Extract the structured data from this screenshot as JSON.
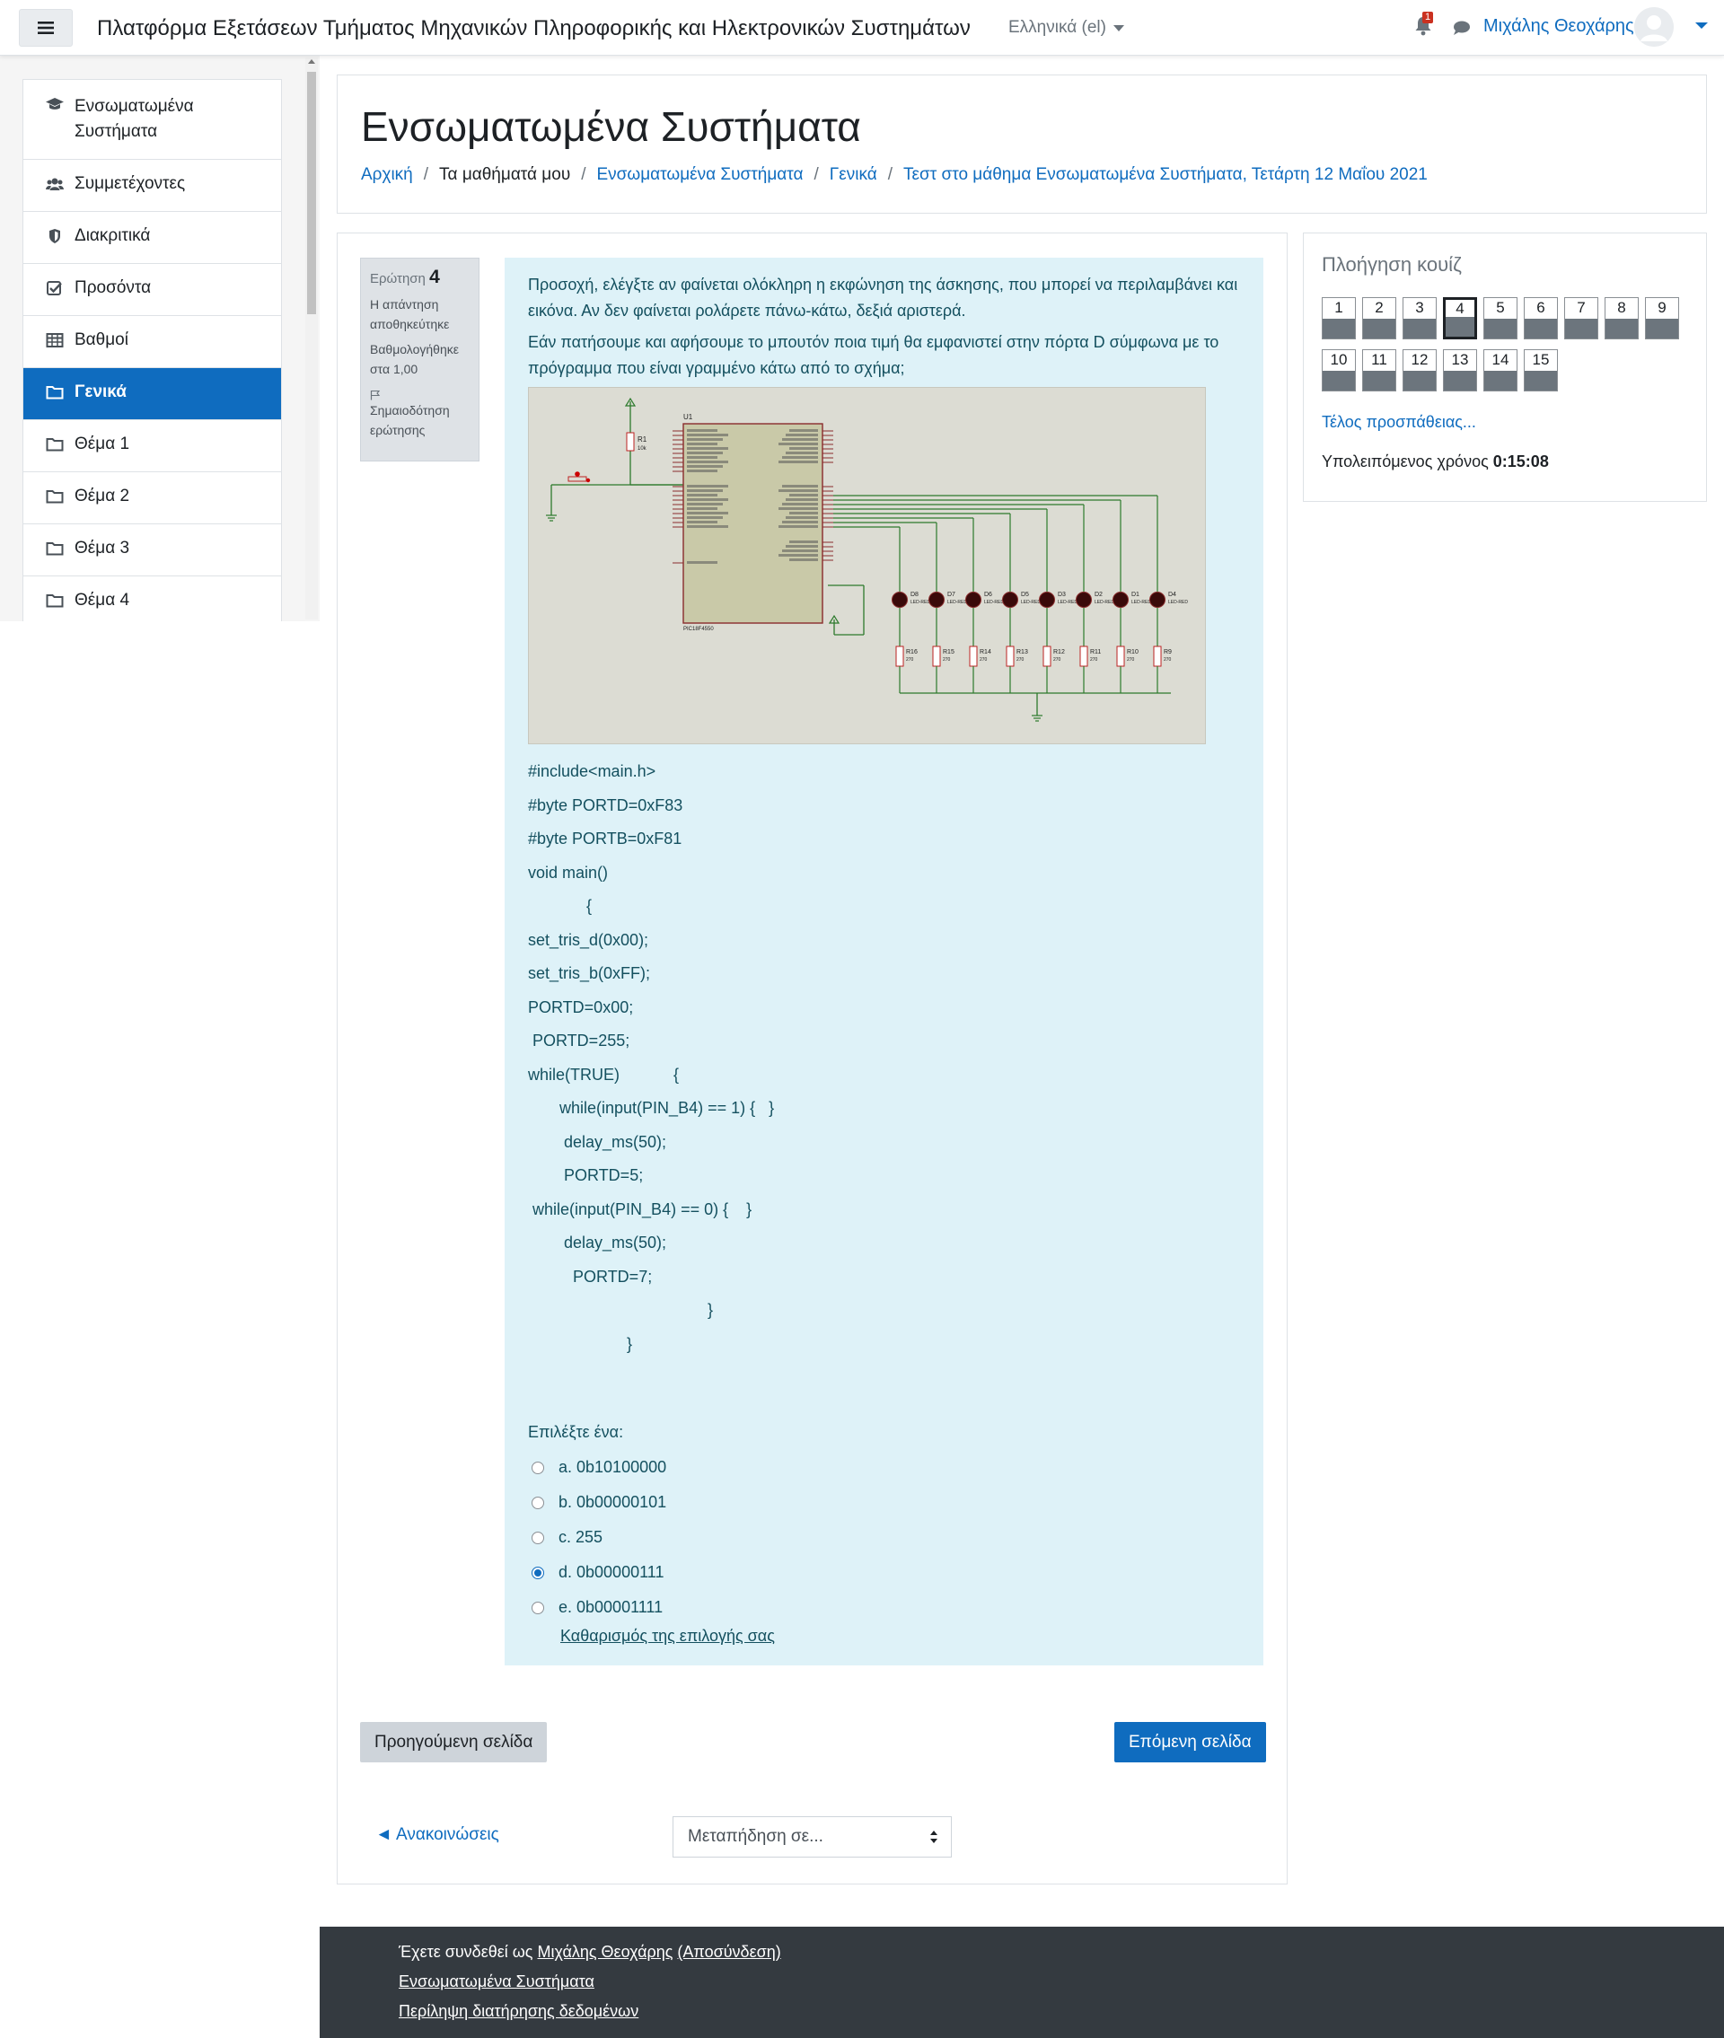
{
  "navbar": {
    "site_name": "Πλατφόρμα Εξετάσεων Τμήματος Μηχανικών Πληροφορικής και Ηλεκτρονικών Συστημάτων",
    "language": "Ελληνικά ‎(el)‎",
    "notification_count": "1",
    "user_name": "Μιχάλης Θεοχάρης",
    "icons": {
      "menu": "hamburger-icon",
      "notifications": "bell-icon",
      "messages": "chat-icon",
      "user": "avatar-icon"
    }
  },
  "drawer": {
    "items": [
      {
        "label": "Ενσωματωμένα Συστήματα",
        "icon": "graduation-cap-icon"
      },
      {
        "label": "Συμμετέχοντες",
        "icon": "users-icon"
      },
      {
        "label": "Διακριτικά",
        "icon": "shield-icon"
      },
      {
        "label": "Προσόντα",
        "icon": "checkbox-icon"
      },
      {
        "label": "Βαθμοί",
        "icon": "table-icon"
      },
      {
        "label": "Γενικά",
        "icon": "folder-icon",
        "active": true
      },
      {
        "label": "Θέμα 1",
        "icon": "folder-icon"
      },
      {
        "label": "Θέμα 2",
        "icon": "folder-icon"
      },
      {
        "label": "Θέμα 3",
        "icon": "folder-icon"
      },
      {
        "label": "Θέμα 4",
        "icon": "folder-icon"
      }
    ]
  },
  "header": {
    "title": "Ενσωματωμένα Συστήματα",
    "breadcrumb": [
      "Αρχική",
      "Τα μαθήματά μου",
      "Ενσωματωμένα Συστήματα",
      "Γενικά",
      "Τεστ στο μάθημα Ενσωματωμένα Συστήματα, Τετάρτη 12 Μαΐου 2021"
    ]
  },
  "question": {
    "info": {
      "label": "Ερώτηση",
      "number": "4",
      "state": "Η απάντηση αποθηκεύτηκε",
      "grade": "Βαθμολογήθηκε στα 1,00",
      "flag": "Σημαιοδότηση ερώτησης"
    },
    "text1": "Προσοχή, ελέγξτε αν φαίνεται ολόκληρη η εκφώνηση της άσκησης, που μπορεί να περιλαμβάνει και εικόνα. Αν δεν φαίνεται ρολάρετε πάνω-κάτω, δεξιά αριστερά.",
    "text2": "Εάν πατήσουμε και αφήσουμε το μπουτόν ποια τιμή θα εμφανιστεί στην πόρτα D σύμφωνα με το πρόγραμμα που είναι γραμμένο κάτω από το σχήμα;",
    "code": [
      "#include<main.h>",
      "#byte PORTD=0xF83",
      "#byte PORTB=0xF81",
      "void main()",
      "             {",
      "set_tris_d(0x00);",
      "set_tris_b(0xFF);",
      "PORTD=0x00;",
      " PORTD=255;",
      "while(TRUE)            {",
      "       while(input(PIN_B4) == 1) {   }",
      "        delay_ms(50);",
      "        PORTD=5;",
      " while(input(PIN_B4) == 0) {    }",
      "        delay_ms(50);",
      "          PORTD=7;",
      "                                        }",
      "                      }"
    ],
    "prompt": "Επιλέξτε ένα:",
    "answers": [
      {
        "label": "a. 0b10100000",
        "checked": false
      },
      {
        "label": "b. 0b00000101",
        "checked": false
      },
      {
        "label": "c. 255",
        "checked": false
      },
      {
        "label": "d. 0b00000111",
        "checked": true
      },
      {
        "label": "e. 0b00001111",
        "checked": false
      }
    ],
    "clear_choice": "Καθαρισμός της επιλογής σας"
  },
  "circuit": {
    "mcu_label": "U1",
    "mcu_part": "PIC18F4550",
    "resistor_top": "R1",
    "resistor_top_value": "10k",
    "leds": [
      "D8",
      "D7",
      "D6",
      "D5",
      "D3",
      "D2",
      "D1",
      "D4"
    ],
    "led_part": "LED-RED",
    "resistors": [
      "R16",
      "R15",
      "R14",
      "R13",
      "R12",
      "R11",
      "R10",
      "R9"
    ],
    "resistor_value": "270"
  },
  "buttons": {
    "prev": "Προηγούμενη σελίδα",
    "next": "Επόμενη σελίδα"
  },
  "activity_nav": {
    "prev_activity": "◄ Ανακοινώσεις",
    "jump_placeholder": "Μεταπήδηση σε..."
  },
  "quiz_nav": {
    "title": "Πλοήγηση κουίζ",
    "current": 4,
    "questions": [
      "1",
      "2",
      "3",
      "4",
      "5",
      "6",
      "7",
      "8",
      "9",
      "10",
      "11",
      "12",
      "13",
      "14",
      "15"
    ],
    "finish": "Τέλος προσπάθειας...",
    "time_label": "Υπολειπόμενος χρόνος",
    "time_value": "0:15:08"
  },
  "footer": {
    "logged_in_prefix": "Έχετε συνδεθεί ως",
    "user": "Μιχάλης Θεοχάρης",
    "logout": "(Αποσύνδεση)",
    "course": "Ενσωματωμένα Συστήματα",
    "data_retention": "Περίληψη διατήρησης δεδομένων"
  },
  "colors": {
    "primary": "#0f6cbf",
    "question_bg": "#def2f8",
    "footer_bg": "#343a40"
  }
}
